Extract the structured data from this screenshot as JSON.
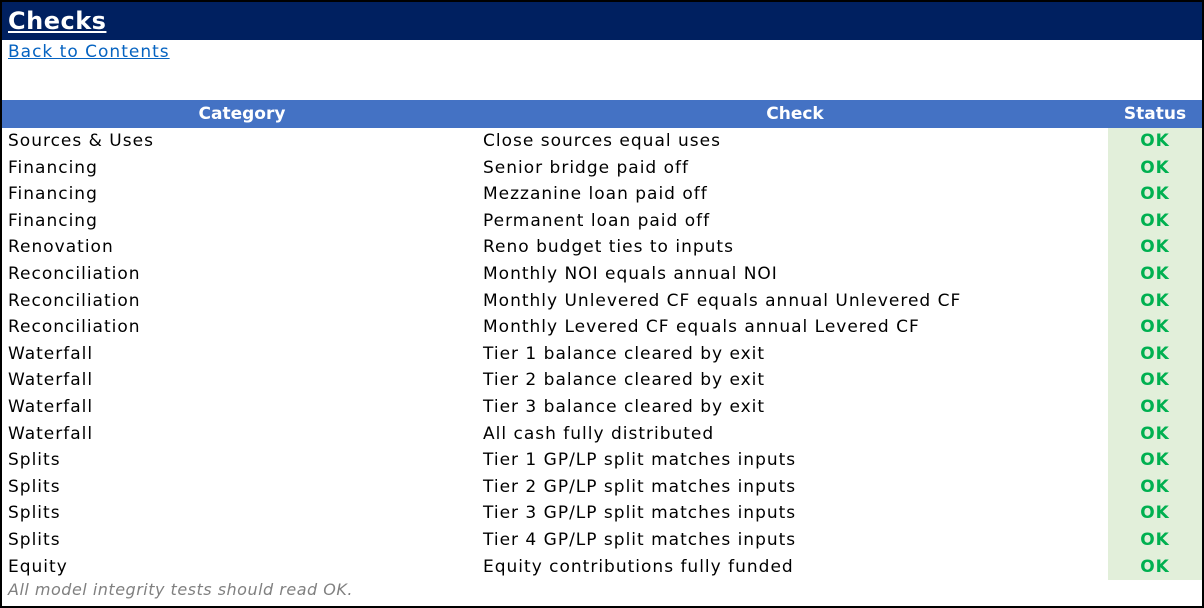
{
  "title": "Checks",
  "back_link": "Back to Contents",
  "columns": {
    "category": "Category",
    "check": "Check",
    "status": "Status"
  },
  "status_color": "#00b050",
  "rows": [
    {
      "category": "Sources & Uses",
      "check": "Close sources equal uses",
      "status": "OK"
    },
    {
      "category": "Financing",
      "check": "Senior bridge paid off",
      "status": "OK"
    },
    {
      "category": "Financing",
      "check": "Mezzanine loan paid off",
      "status": "OK"
    },
    {
      "category": "Financing",
      "check": "Permanent loan paid off",
      "status": "OK"
    },
    {
      "category": "Renovation",
      "check": "Reno budget ties to inputs",
      "status": "OK"
    },
    {
      "category": "Reconciliation",
      "check": "Monthly NOI equals annual NOI",
      "status": "OK"
    },
    {
      "category": "Reconciliation",
      "check": "Monthly Unlevered CF equals annual Unlevered CF",
      "status": "OK"
    },
    {
      "category": "Reconciliation",
      "check": "Monthly Levered CF equals annual Levered CF",
      "status": "OK"
    },
    {
      "category": "Waterfall",
      "check": "Tier 1 balance cleared by exit",
      "status": "OK"
    },
    {
      "category": "Waterfall",
      "check": "Tier 2 balance cleared by exit",
      "status": "OK"
    },
    {
      "category": "Waterfall",
      "check": "Tier 3 balance cleared by exit",
      "status": "OK"
    },
    {
      "category": "Waterfall",
      "check": "All cash fully distributed",
      "status": "OK"
    },
    {
      "category": "Splits",
      "check": "Tier 1 GP/LP split matches inputs",
      "status": "OK"
    },
    {
      "category": "Splits",
      "check": "Tier 2 GP/LP split matches inputs",
      "status": "OK"
    },
    {
      "category": "Splits",
      "check": "Tier 3 GP/LP split matches inputs",
      "status": "OK"
    },
    {
      "category": "Splits",
      "check": "Tier 4 GP/LP split matches inputs",
      "status": "OK"
    },
    {
      "category": "Equity",
      "check": "Equity contributions fully funded",
      "status": "OK"
    }
  ],
  "footnote": "All model integrity tests should read OK."
}
